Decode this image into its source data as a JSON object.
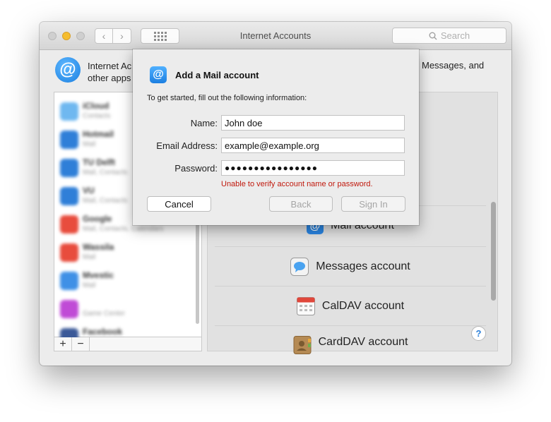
{
  "window": {
    "title": "Internet Accounts",
    "search_placeholder": "Search",
    "header_text_left": "Internet Ac",
    "header_text_left2": "other apps",
    "header_text_right": "Messages, and"
  },
  "accounts": [
    {
      "name": "iCloud",
      "sub": "Contacts",
      "icon": "cloud-icon",
      "color": "#6fb8f0"
    },
    {
      "name": "Hotmail",
      "sub": "Mail",
      "icon": "exchange-icon",
      "color": "#2f7fd8"
    },
    {
      "name": "TU Delft",
      "sub": "Mail, Contacts",
      "icon": "exchange-icon",
      "color": "#2f7fd8"
    },
    {
      "name": "VU",
      "sub": "Mail, Contacts",
      "icon": "exchange-icon",
      "color": "#2f7fd8"
    },
    {
      "name": "Google",
      "sub": "Mail, Contacts, Calendars",
      "icon": "google-icon",
      "color": "#e84c3d"
    },
    {
      "name": "Wassila",
      "sub": "Mail",
      "icon": "google-icon",
      "color": "#e84c3d"
    },
    {
      "name": "Mvestic",
      "sub": "Mail",
      "icon": "mail-icon",
      "color": "#3f90e6"
    },
    {
      "name": "",
      "sub": "Game Center",
      "icon": "game-center-icon",
      "color": "#c04bd6"
    },
    {
      "name": "Facebook",
      "sub": "",
      "icon": "facebook-icon",
      "color": "#3b5998"
    }
  ],
  "providers": [
    {
      "label": "Mail account",
      "icon": "at-icon"
    },
    {
      "label": "Messages account",
      "icon": "messages-icon"
    },
    {
      "label": "CalDAV account",
      "icon": "calendar-icon"
    },
    {
      "label": "CardDAV account",
      "icon": "contacts-icon"
    }
  ],
  "sheet": {
    "title": "Add a Mail account",
    "intro": "To get started, fill out the following information:",
    "name_label": "Name:",
    "name_value": "John doe",
    "email_label": "Email Address:",
    "email_value": "example@example.org",
    "password_label": "Password:",
    "password_value": "●●●●●●●●●●●●●●●●",
    "error": "Unable to verify account name or password.",
    "cancel": "Cancel",
    "back": "Back",
    "sign_in": "Sign In"
  },
  "colors": {
    "accent": "#1c7fe1",
    "error": "#c0180c"
  }
}
